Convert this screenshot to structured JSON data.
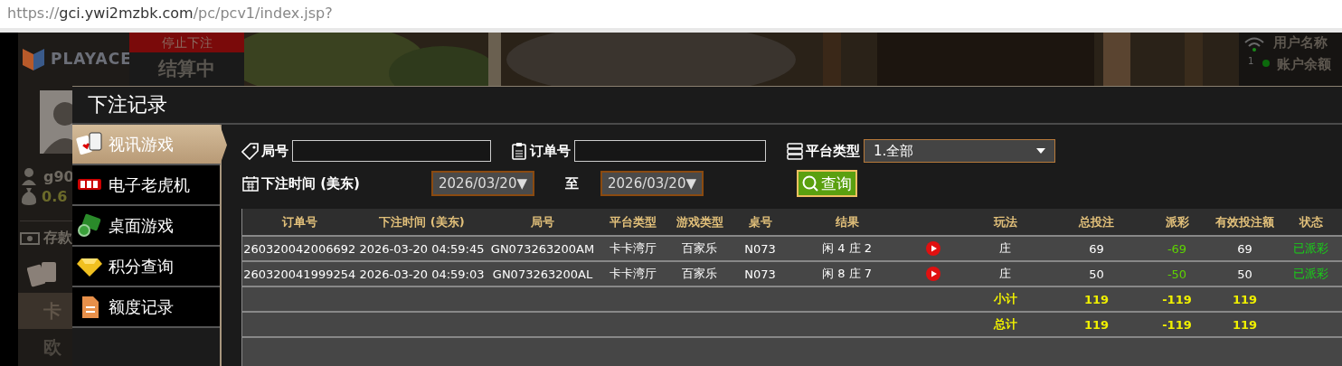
{
  "browser": {
    "url": {
      "scheme": "https://",
      "host": "gci.ywi2mzbk.com",
      "path": "/pc/pcv1/index.jsp?"
    }
  },
  "background": {
    "logo": "PLAYACE",
    "bet_status": "停止下注",
    "round_status": "结算中",
    "username": "g90",
    "balance": "0.6",
    "deposit": "存款",
    "table_tab": "卡",
    "region_tab": "欧",
    "info": [
      "用户名称",
      "账户余额"
    ],
    "line_number": "1"
  },
  "modal": {
    "title": "下注记录",
    "menu": [
      {
        "label": "视讯游戏",
        "kind": "cards",
        "selected": true
      },
      {
        "label": "电子老虎机",
        "kind": "slots",
        "selected": false
      },
      {
        "label": "桌面游戏",
        "kind": "chips",
        "selected": false
      },
      {
        "label": "积分查询",
        "kind": "diamond",
        "selected": false
      },
      {
        "label": "额度记录",
        "kind": "document",
        "selected": false
      }
    ],
    "filters": {
      "round_no": {
        "label": "局号"
      },
      "order_no": {
        "label": "订单号"
      },
      "platform": {
        "label": "平台类型",
        "value": "1.全部"
      },
      "bet_time": {
        "label": "下注时间 (美东)",
        "from": "2026/03/20▼",
        "separator": "至",
        "to": "2026/03/20▼"
      },
      "query_button": "查询"
    },
    "table": {
      "columns": [
        "订单号",
        "下注时间 (美东)",
        "局号",
        "平台类型",
        "游戏类型",
        "桌号",
        "结果",
        "玩法",
        "总投注",
        "派彩",
        "有效投注额",
        "状态"
      ],
      "rows": [
        {
          "kind": "bet",
          "replay": true,
          "cells": [
            "260320042006692",
            "2026-03-20 04:59:45",
            "GN073263200AM",
            "卡卡湾厅",
            "百家乐",
            "N073",
            "闲 4 庄 2",
            "庄",
            "69",
            "-69",
            "69",
            "已派彩"
          ]
        },
        {
          "kind": "bet",
          "replay": true,
          "cells": [
            "260320041999254",
            "2026-03-20 04:59:03",
            "GN073263200AL",
            "卡卡湾厅",
            "百家乐",
            "N073",
            "闲 8 庄 7",
            "庄",
            "50",
            "-50",
            "50",
            "已派彩"
          ]
        },
        {
          "kind": "summary",
          "label": "小计",
          "total_bet": "119",
          "payout": "-119",
          "valid_bet": "119"
        },
        {
          "kind": "summary",
          "label": "总计",
          "total_bet": "119",
          "payout": "-119",
          "valid_bet": "119"
        }
      ]
    }
  }
}
